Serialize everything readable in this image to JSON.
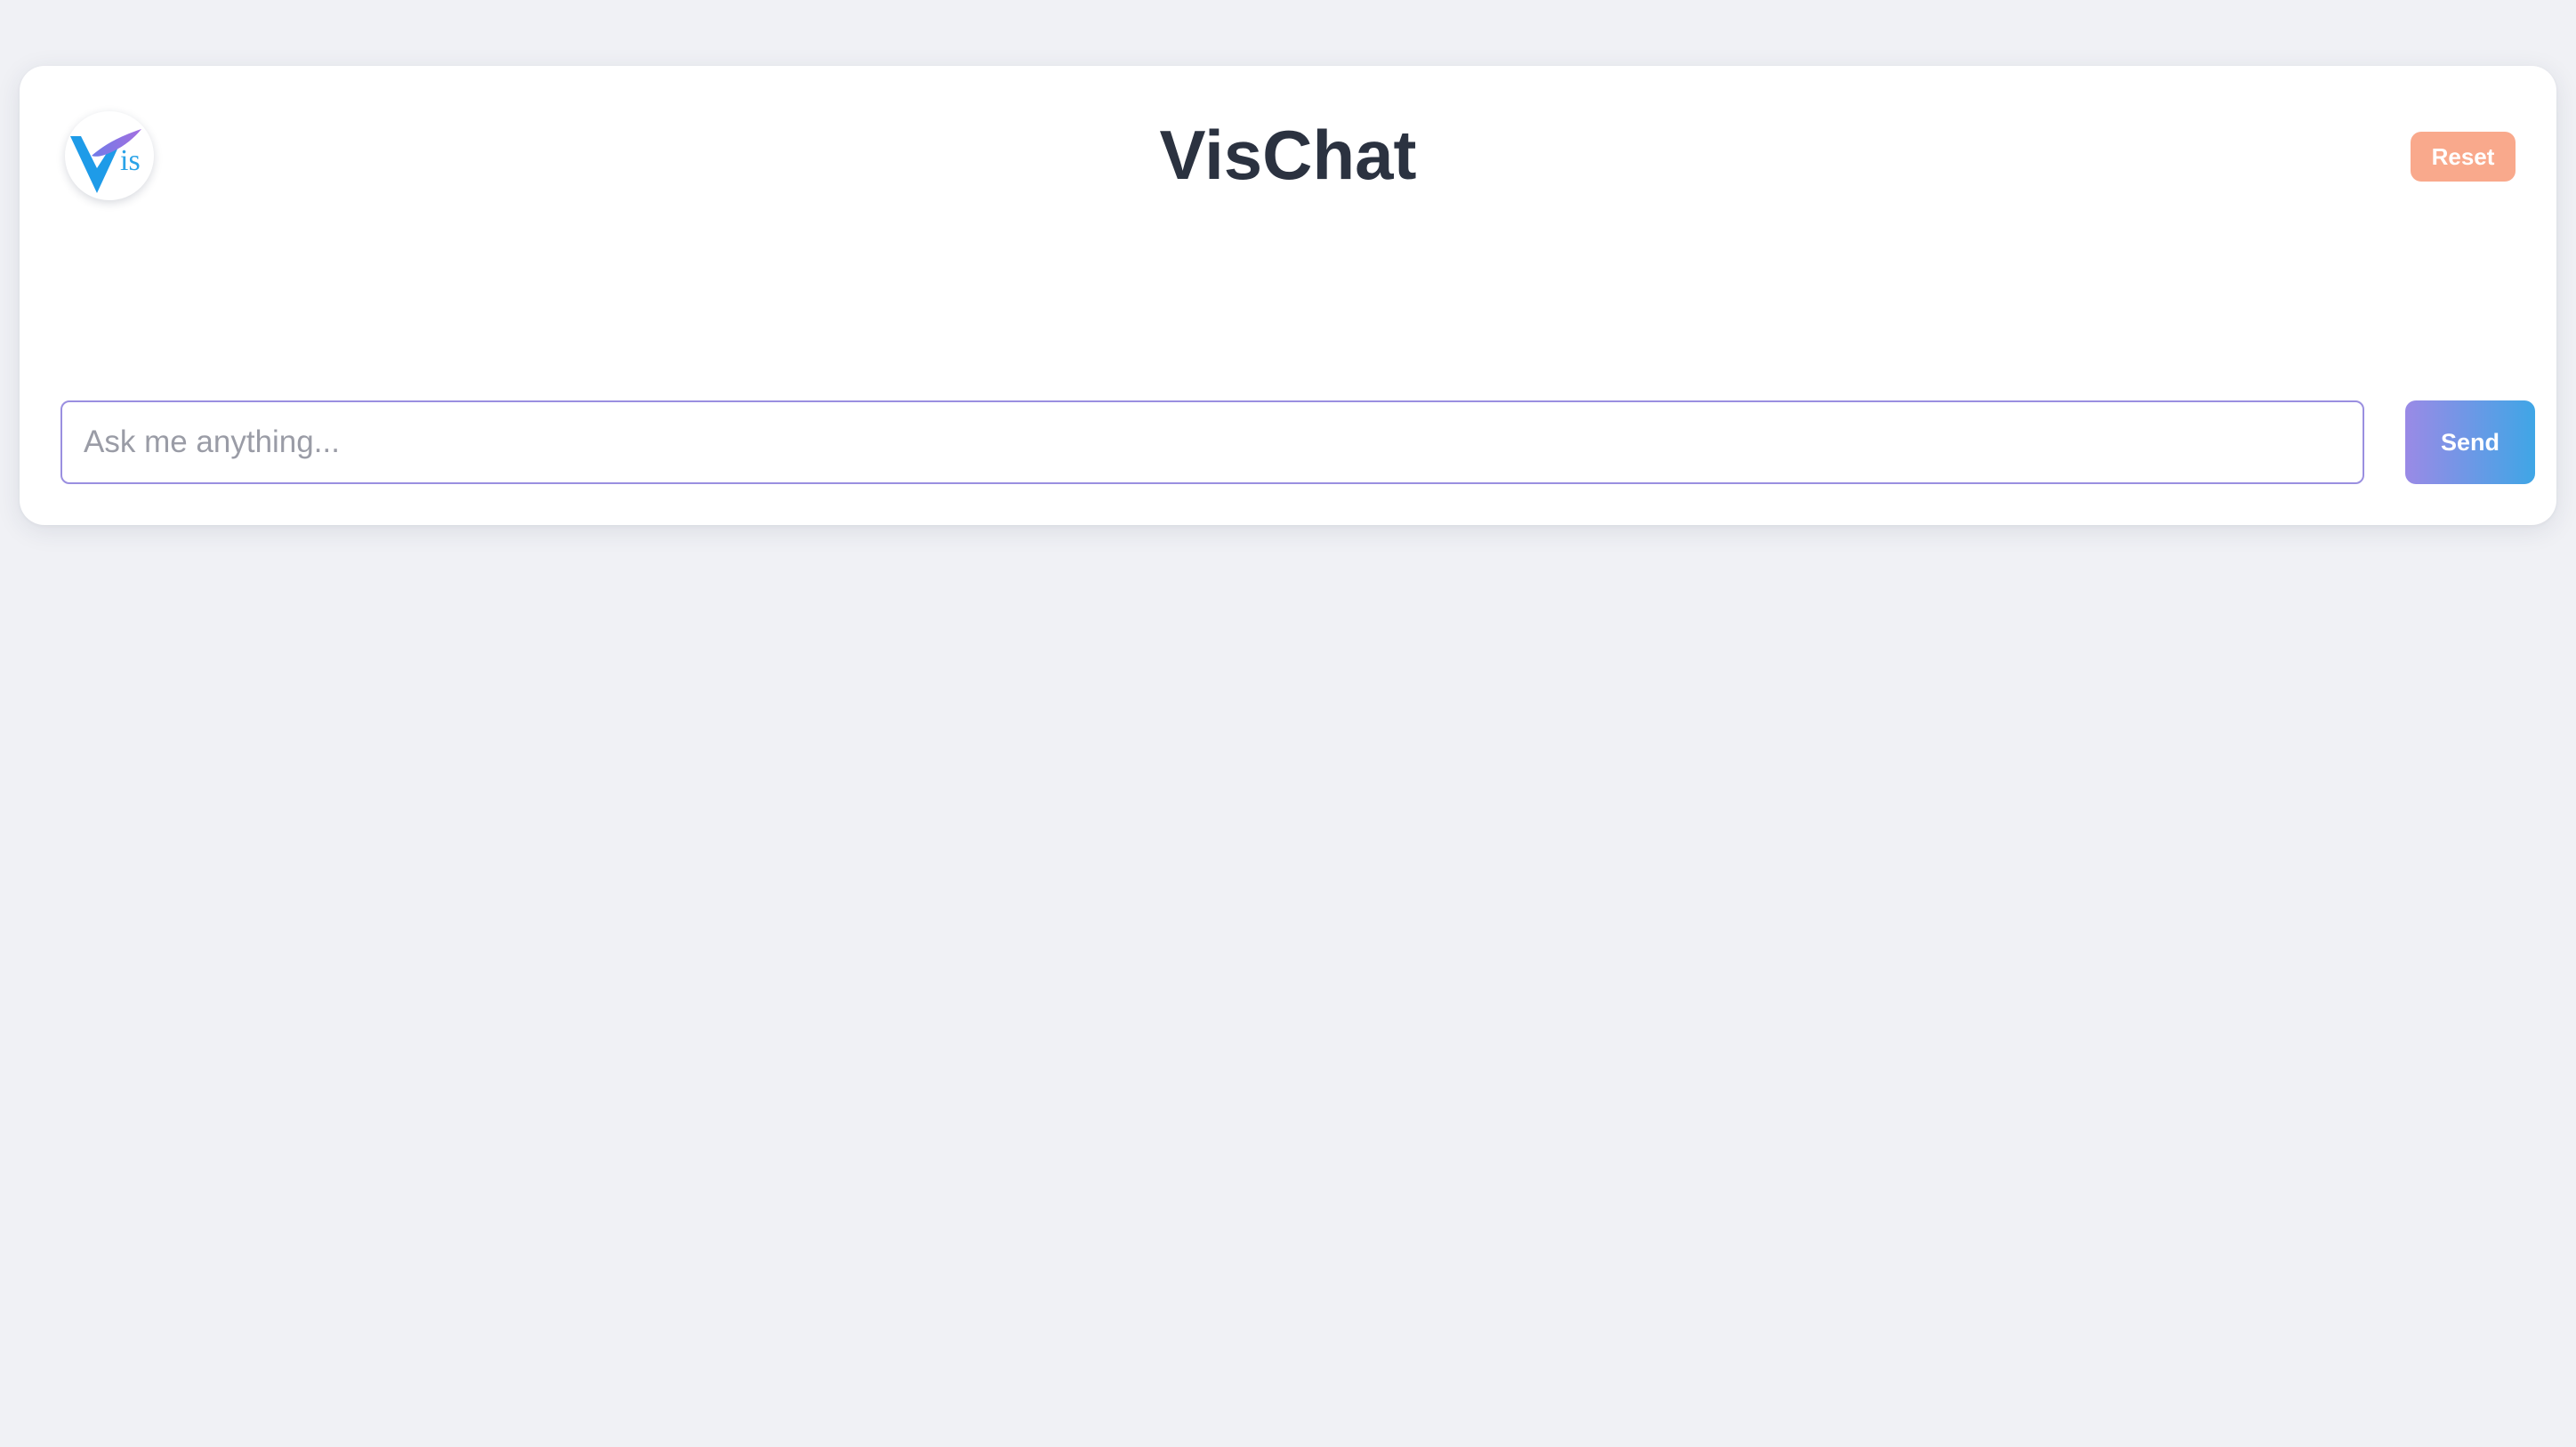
{
  "app": {
    "title": "VisChat",
    "logo_text": "is",
    "logo_icon": "vis-logo-icon"
  },
  "header": {
    "reset_label": "Reset"
  },
  "composer": {
    "placeholder": "Ask me anything...",
    "value": "",
    "send_label": "Send"
  },
  "colors": {
    "page_background": "#f0f1f5",
    "card_background": "#ffffff",
    "title_text": "#2b3240",
    "reset_button": "#f9a98c",
    "send_gradient_start": "#9a8ae6",
    "send_gradient_end": "#3fa6e6",
    "input_border": "#9a8fe0",
    "logo_blue": "#1e9be8",
    "logo_purple": "#8a6fe0"
  }
}
